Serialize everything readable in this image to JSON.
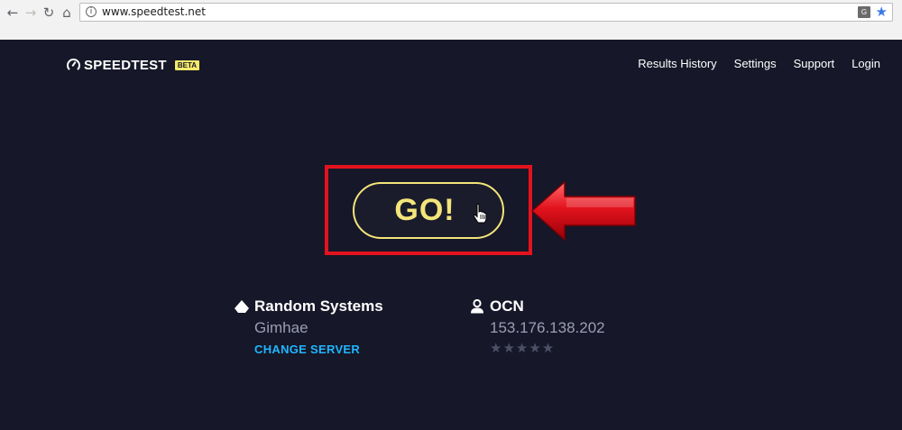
{
  "browser": {
    "url": "www.speedtest.net",
    "back_glyph": "←",
    "forward_glyph": "→",
    "reload_glyph": "↻",
    "home_glyph": "⌂",
    "info_glyph": "i",
    "translate_glyph": "G",
    "star_glyph": "★"
  },
  "header": {
    "logo_text": "SPEEDTEST",
    "beta_label": "BETA",
    "nav": [
      "Results History",
      "Settings",
      "Support",
      "Login"
    ]
  },
  "main": {
    "go_label": "GO!",
    "server": {
      "name": "Random Systems",
      "location": "Gimhae",
      "change_label": "CHANGE SERVER"
    },
    "isp": {
      "name": "OCN",
      "ip": "153.176.138.202",
      "rating_stars": "★★★★★",
      "rating": 0
    }
  },
  "colors": {
    "background": "#161728",
    "accent_yellow": "#f4e57a",
    "link_blue": "#1fb6ff",
    "highlight_red": "#e3131e"
  }
}
